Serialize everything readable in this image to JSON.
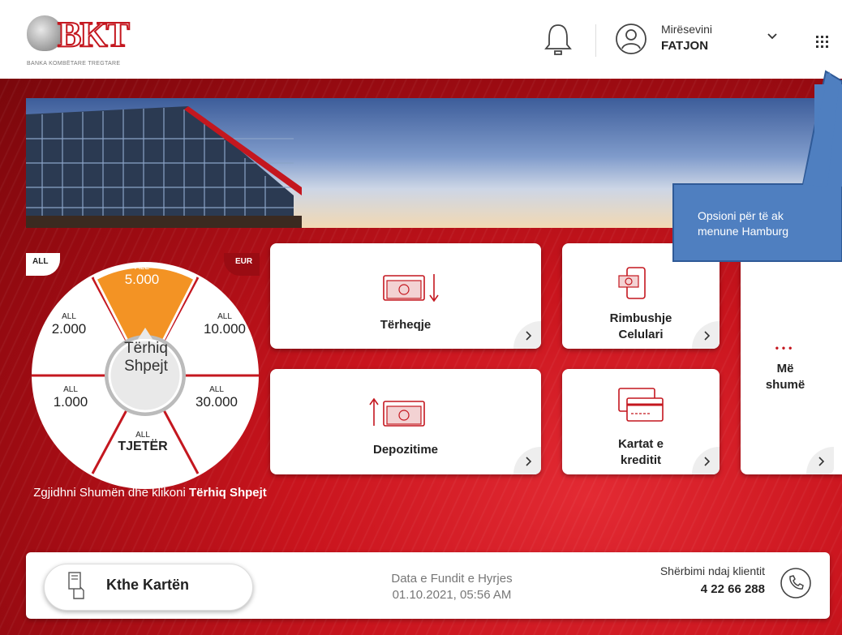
{
  "header": {
    "logo_text": "BKT",
    "logo_subtitle": "BANKA KOMBËTARE TREGTARE",
    "greeting": "Mirësevini",
    "user_name": "FATJON"
  },
  "quick_withdraw": {
    "currency_left": "ALL",
    "currency_right": "EUR",
    "segments": [
      {
        "currency": "ALL",
        "amount": "5.000",
        "selected": true
      },
      {
        "currency": "ALL",
        "amount": "10.000"
      },
      {
        "currency": "ALL",
        "amount": "30.000"
      },
      {
        "currency": "ALL",
        "amount": "TJETËR"
      },
      {
        "currency": "ALL",
        "amount": "1.000"
      },
      {
        "currency": "ALL",
        "amount": "2.000"
      }
    ],
    "center_line1": "Tërhiq",
    "center_line2": "Shpejt",
    "hint_prefix": "Zgjidhni Shumën dhe klikoni ",
    "hint_bold": "Tërhiq Shpejt"
  },
  "tiles": {
    "withdraw": "Tërheqje",
    "topup_line1": "Rimbushje",
    "topup_line2": "Celulari",
    "deposit": "Depozitime",
    "cards_line1": "Kartat e",
    "cards_line2": "kreditit",
    "more_line1": "Më",
    "more_line2": "shumë"
  },
  "footer": {
    "return_card": "Kthe Kartën",
    "last_login_label": "Data e Fundit e Hyrjes",
    "last_login_value": "01.10.2021, 05:56 AM",
    "service_label": "Shërbimi ndaj klientit",
    "service_phone": "4 22 66 288"
  },
  "callout": {
    "line1": "Opsioni për të ak",
    "line2": "menune Hamburg"
  },
  "colors": {
    "brand_red": "#c4171f",
    "accent_orange": "#f39324",
    "callout_blue": "#4f7fc0"
  }
}
